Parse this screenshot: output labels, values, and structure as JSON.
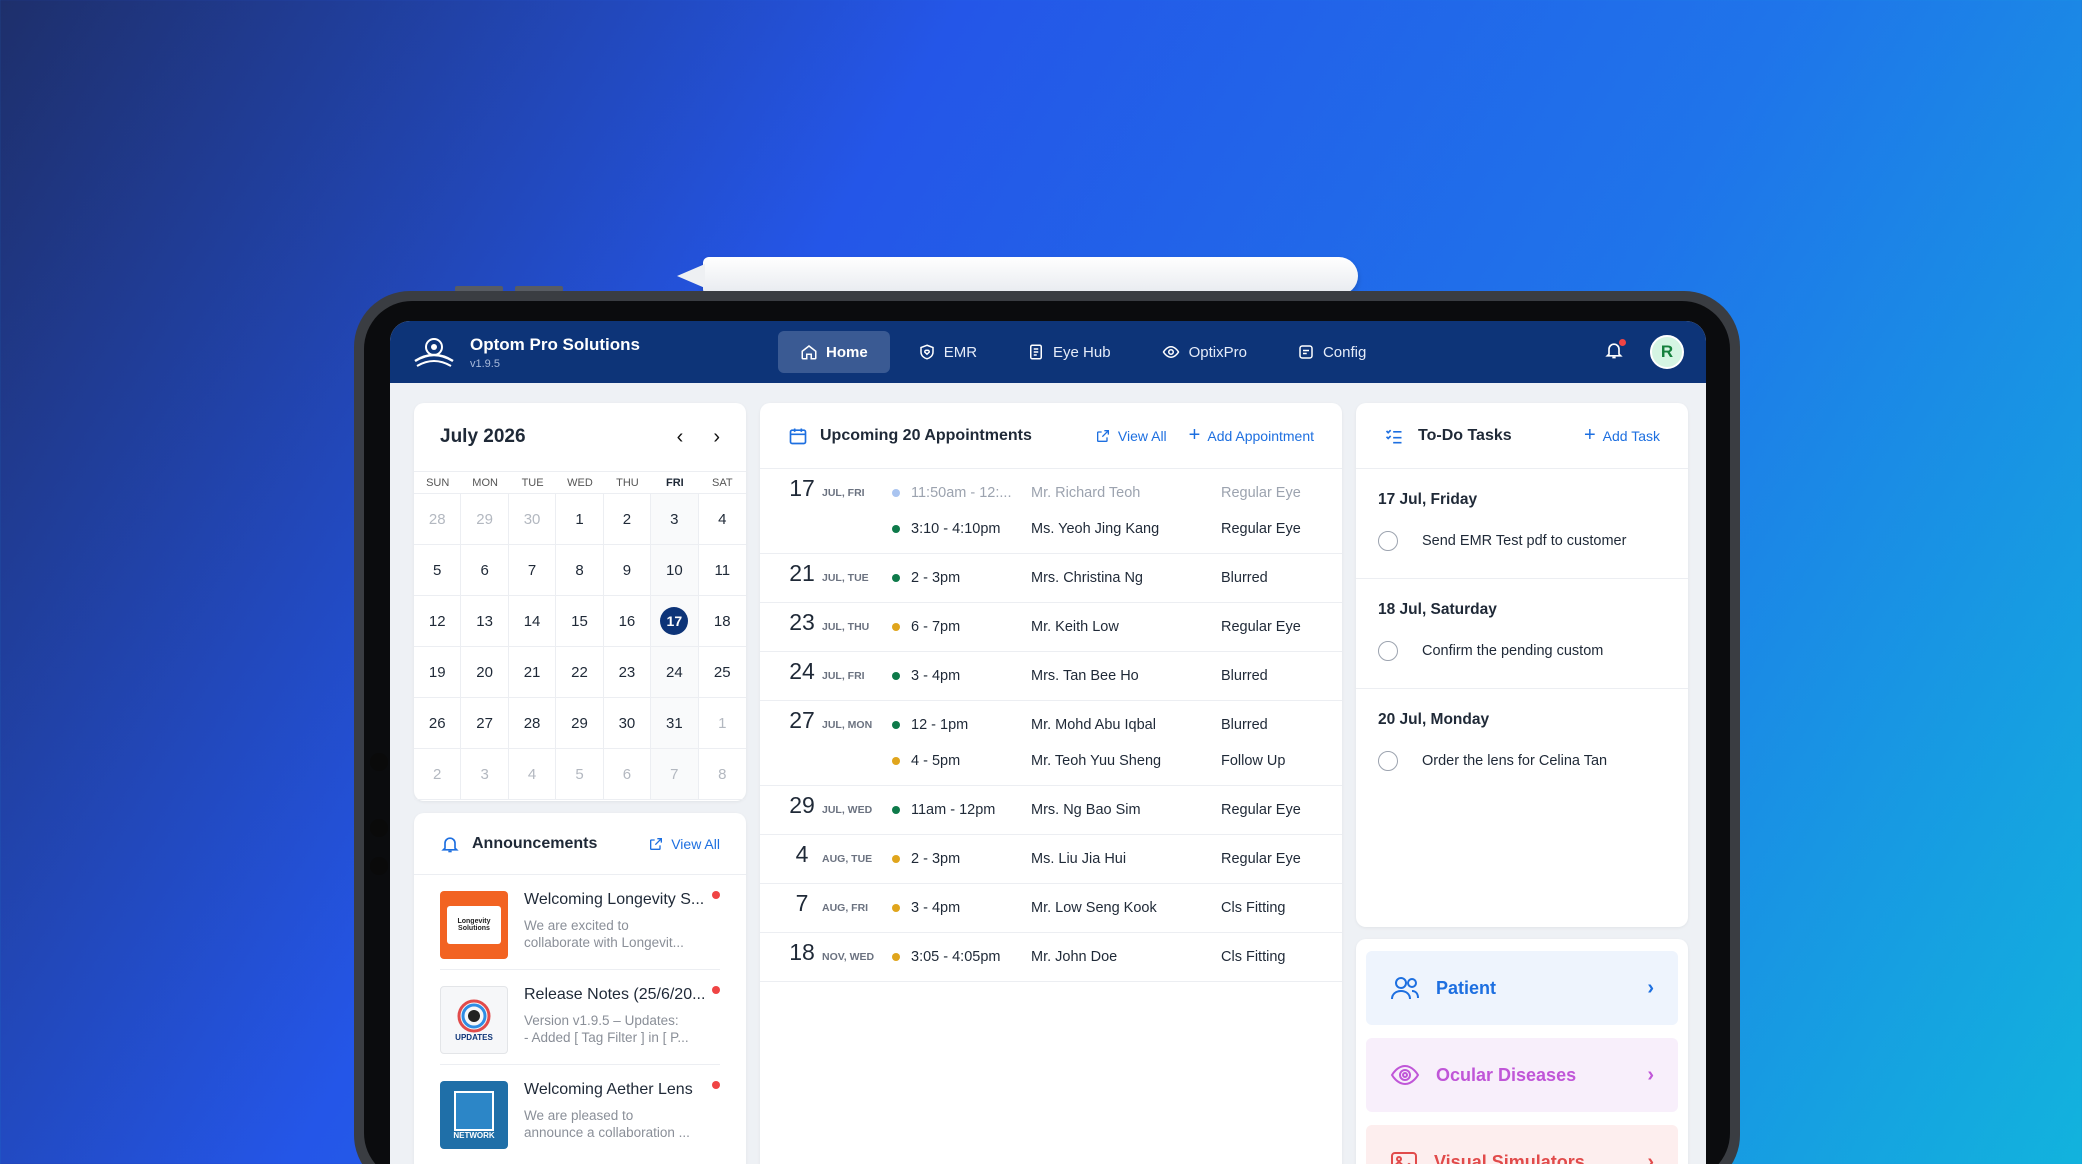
{
  "app": {
    "name": "Optom Pro Solutions",
    "version": "v1.9.5"
  },
  "nav": {
    "items": [
      {
        "label": "Home",
        "icon": "home-icon",
        "active": true
      },
      {
        "label": "EMR",
        "icon": "heart-shield-icon"
      },
      {
        "label": "Eye Hub",
        "icon": "book-icon"
      },
      {
        "label": "OptixPro",
        "icon": "eye-icon"
      },
      {
        "label": "Config",
        "icon": "settings-icon"
      }
    ],
    "avatar": "R"
  },
  "calendar": {
    "month": "July 2026",
    "weekdays": [
      "SUN",
      "MON",
      "TUE",
      "WED",
      "THU",
      "FRI",
      "SAT"
    ],
    "days": [
      "28",
      "29",
      "30",
      "1",
      "2",
      "3",
      "4",
      "5",
      "6",
      "7",
      "8",
      "9",
      "10",
      "11",
      "12",
      "13",
      "14",
      "15",
      "16",
      "17",
      "18",
      "19",
      "20",
      "21",
      "22",
      "23",
      "24",
      "25",
      "26",
      "27",
      "28",
      "29",
      "30",
      "31",
      "1",
      "2",
      "3",
      "4",
      "5",
      "6",
      "7",
      "8"
    ],
    "selected": "17"
  },
  "announcements": {
    "title": "Announcements",
    "view_all": "View All",
    "items": [
      {
        "title": "Welcoming Longevity S...",
        "desc1": "We are excited to",
        "desc2": "collaborate with Longevit...",
        "thumb_text": "Longevity Solutions"
      },
      {
        "title": "Release Notes (25/6/20...",
        "desc1": "Version v1.9.5 – Updates:",
        "desc2": "- Added [ Tag Filter ] in [ P...",
        "thumb_text": "UPDATES"
      },
      {
        "title": "Welcoming Aether Lens",
        "desc1": "We are pleased to",
        "desc2": "announce a collaboration ...",
        "thumb_text": "NETWORK"
      }
    ]
  },
  "appointments": {
    "title": "Upcoming 20 Appointments",
    "view_all": "View All",
    "add": "Add Appointment",
    "groups": [
      {
        "day": "17",
        "label": "JUL, FRI",
        "rows": [
          {
            "time": "11:50am - 12:...",
            "name": "Mr. Richard Teoh",
            "type": "Regular Eye",
            "status": "past"
          },
          {
            "time": "3:10 - 4:10pm",
            "name": "Ms. Yeoh Jing Kang",
            "type": "Regular Eye",
            "status": "green"
          }
        ]
      },
      {
        "day": "21",
        "label": "JUL, TUE",
        "rows": [
          {
            "time": "2 - 3pm",
            "name": "Mrs. Christina Ng",
            "type": "Blurred",
            "status": "green"
          }
        ]
      },
      {
        "day": "23",
        "label": "JUL, THU",
        "rows": [
          {
            "time": "6 - 7pm",
            "name": "Mr. Keith Low",
            "type": "Regular Eye",
            "status": "amber"
          }
        ]
      },
      {
        "day": "24",
        "label": "JUL, FRI",
        "rows": [
          {
            "time": "3 - 4pm",
            "name": "Mrs. Tan Bee Ho",
            "type": "Blurred",
            "status": "green"
          }
        ]
      },
      {
        "day": "27",
        "label": "JUL, MON",
        "rows": [
          {
            "time": "12 - 1pm",
            "name": "Mr. Mohd Abu Iqbal",
            "type": "Blurred",
            "status": "green"
          },
          {
            "time": "4 - 5pm",
            "name": "Mr. Teoh Yuu Sheng",
            "type": "Follow Up",
            "status": "amber"
          }
        ]
      },
      {
        "day": "29",
        "label": "JUL, WED",
        "rows": [
          {
            "time": "11am - 12pm",
            "name": "Mrs. Ng Bao Sim",
            "type": "Regular Eye",
            "status": "green"
          }
        ]
      },
      {
        "day": "4",
        "label": "AUG, TUE",
        "rows": [
          {
            "time": "2 - 3pm",
            "name": "Ms. Liu Jia Hui",
            "type": "Regular Eye",
            "status": "amber"
          }
        ]
      },
      {
        "day": "7",
        "label": "AUG, FRI",
        "rows": [
          {
            "time": "3 - 4pm",
            "name": "Mr. Low Seng Kook",
            "type": "Cls Fitting",
            "status": "amber"
          }
        ]
      },
      {
        "day": "18",
        "label": "NOV, WED",
        "rows": [
          {
            "time": "3:05 - 4:05pm",
            "name": "Mr. John Doe",
            "type": "Cls Fitting",
            "status": "amber"
          }
        ]
      }
    ]
  },
  "todo": {
    "title": "To-Do Tasks",
    "add": "Add Task",
    "groups": [
      {
        "date": "17 Jul, Friday",
        "task": "Send EMR Test pdf to customer"
      },
      {
        "date": "18 Jul, Saturday",
        "task": "Confirm the pending custom"
      },
      {
        "date": "20 Jul, Monday",
        "task": "Order the lens for Celina Tan"
      }
    ]
  },
  "quick_links": [
    {
      "label": "Patient",
      "color": "#1d6fe0",
      "bg": "#eef4fd",
      "icon": "users-icon"
    },
    {
      "label": "Ocular Diseases",
      "color": "#c056d8",
      "bg": "#f8effb",
      "icon": "eye-icon"
    },
    {
      "label": "Visual Simulators",
      "color": "#e14b4b",
      "bg": "#fdeeee",
      "icon": "image-icon"
    }
  ],
  "colors": {
    "nav": "#0d3478",
    "accent": "#1d6fe0",
    "green": "#0e7a4a",
    "amber": "#e0a51c",
    "past": "#a9c4f0"
  }
}
